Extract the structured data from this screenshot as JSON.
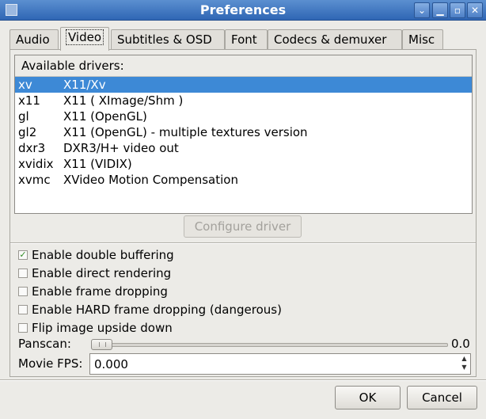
{
  "window": {
    "title": "Preferences",
    "controls": [
      "chevron-down-icon",
      "minimize-icon",
      "maximize-icon",
      "close-icon"
    ]
  },
  "tabs": [
    {
      "label": "Audio",
      "active": false
    },
    {
      "label": "Video",
      "active": true
    },
    {
      "label": "Subtitles & OSD",
      "active": false
    },
    {
      "label": "Font",
      "active": false
    },
    {
      "label": "Codecs & demuxer",
      "active": false
    },
    {
      "label": "Misc",
      "active": false
    }
  ],
  "drivers": {
    "header": "Available drivers:",
    "selected": "xv",
    "rows": [
      {
        "name": "xv",
        "desc": "X11/Xv"
      },
      {
        "name": "x11",
        "desc": "X11 ( XImage/Shm )"
      },
      {
        "name": "gl",
        "desc": "X11 (OpenGL)"
      },
      {
        "name": "gl2",
        "desc": "X11 (OpenGL) - multiple textures version"
      },
      {
        "name": "dxr3",
        "desc": "DXR3/H+ video out"
      },
      {
        "name": "xvidix",
        "desc": "X11 (VIDIX)"
      },
      {
        "name": "xvmc",
        "desc": "XVideo Motion Compensation"
      }
    ]
  },
  "configure_button": "Configure driver",
  "options": [
    {
      "label": "Enable double buffering",
      "checked": true
    },
    {
      "label": "Enable direct rendering",
      "checked": false
    },
    {
      "label": "Enable frame dropping",
      "checked": false
    },
    {
      "label": "Enable HARD frame dropping (dangerous)",
      "checked": false
    },
    {
      "label": "Flip image upside down",
      "checked": false
    }
  ],
  "panscan": {
    "label": "Panscan:",
    "value": "0.0",
    "level": 0.0
  },
  "fps": {
    "label": "Movie FPS:",
    "value": "0.000"
  },
  "buttons": {
    "ok": "OK",
    "cancel": "Cancel"
  },
  "colors": {
    "selection": "#3d89d6",
    "titlebar": "#2f66b4",
    "check": "#2f8a23"
  }
}
